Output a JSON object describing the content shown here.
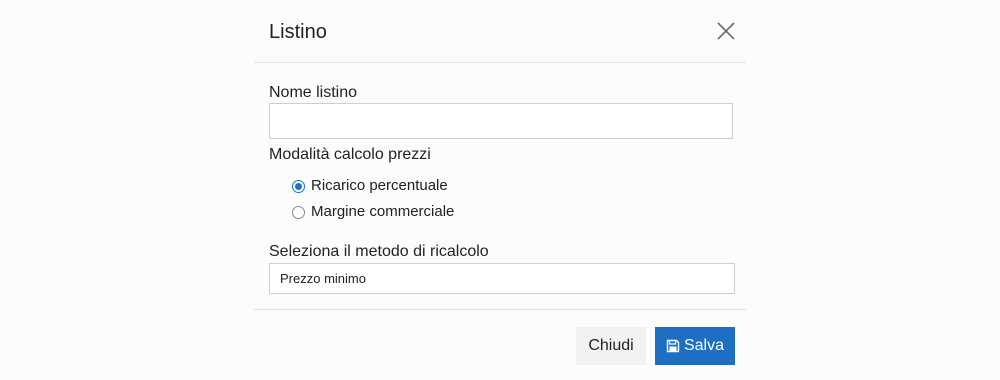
{
  "modal": {
    "title": "Listino",
    "close_icon": "close-icon"
  },
  "form": {
    "name_label": "Nome listino",
    "name_value": "",
    "name_placeholder": "",
    "mode_label": "Modalità calcolo prezzi",
    "mode_options": [
      {
        "label": "Ricarico percentuale",
        "checked": true
      },
      {
        "label": "Margine commerciale",
        "checked": false
      }
    ],
    "recalc_label": "Seleziona il metodo di ricalcolo",
    "recalc_value": "Prezzo minimo"
  },
  "footer": {
    "close_label": "Chiudi",
    "save_label": "Salva",
    "save_icon": "floppy-disk-icon"
  },
  "colors": {
    "primary": "#1e6fc4",
    "radio_accent": "#1b6fd0",
    "secondary_button": "#f2f2f2",
    "divider": "#e3e3e3"
  }
}
